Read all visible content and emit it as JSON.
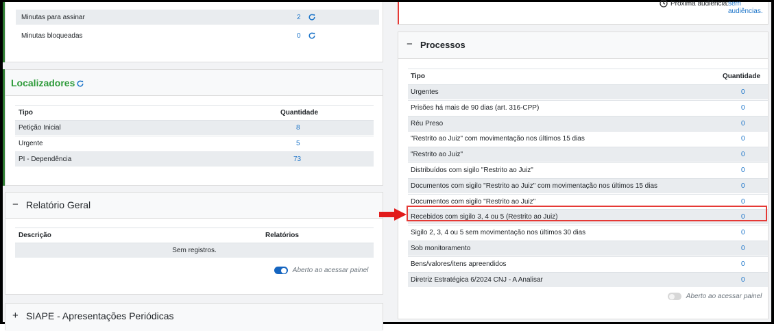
{
  "minutas": {
    "items": [
      {
        "label": "Minutas para assinar",
        "count": "2"
      },
      {
        "label": "Minutas bloqueadas",
        "count": "0"
      }
    ]
  },
  "localizadores": {
    "title": "Localizadores",
    "col_tipo": "Tipo",
    "col_quantidade": "Quantidade",
    "rows": [
      {
        "tipo": "Petição Inicial",
        "qtd": "8"
      },
      {
        "tipo": "Urgente",
        "qtd": "5"
      },
      {
        "tipo": "PI - Dependência",
        "qtd": "73"
      }
    ]
  },
  "relatorio": {
    "toggle_symbol": "−",
    "title": "Relatório Geral",
    "col_descricao": "Descrição",
    "col_relatorios": "Relatórios",
    "empty": "Sem registros.",
    "aberto_label": "Aberto ao acessar painel"
  },
  "siape": {
    "toggle_symbol": "+",
    "title": "SIAPE - Apresentações Periódicas"
  },
  "audiencia": {
    "label": "Próxima audiência:",
    "value": "sem audiências."
  },
  "processos": {
    "toggle_symbol": "−",
    "title": "Processos",
    "col_tipo": "Tipo",
    "col_quantidade": "Quantidade",
    "rows": [
      {
        "tipo": "Urgentes",
        "qtd": "0"
      },
      {
        "tipo": "Prisões há mais de 90 dias (art. 316-CPP)",
        "qtd": "0"
      },
      {
        "tipo": "Réu Preso",
        "qtd": "0"
      },
      {
        "tipo": "\"Restrito ao Juiz\" com movimentação nos últimos 15 dias",
        "qtd": "0"
      },
      {
        "tipo": "\"Restrito ao Juiz\"",
        "qtd": "0"
      },
      {
        "tipo": "Distribuídos com sigilo \"Restrito ao Juiz\"",
        "qtd": "0"
      },
      {
        "tipo": "Documentos com sigilo \"Restrito ao Juiz\" com movimentação nos últimos 15 dias",
        "qtd": "0"
      },
      {
        "tipo": "Documentos com sigilo \"Restrito ao Juiz\"",
        "qtd": "0"
      },
      {
        "tipo": "Recebidos com sigilo 3, 4 ou 5 (Restrito ao Juiz)",
        "qtd": "0"
      },
      {
        "tipo": "Sigilo 2, 3, 4 ou 5 sem movimentação nos últimos 30 dias",
        "qtd": "0"
      },
      {
        "tipo": "Sob monitoramento",
        "qtd": "0"
      },
      {
        "tipo": "Bens/valores/itens apreendidos",
        "qtd": "0"
      },
      {
        "tipo": "Diretriz Estratégica 6/2024 CNJ - A Analisar",
        "qtd": "0"
      }
    ],
    "aberto_label": "Aberto ao acessar painel"
  },
  "colors": {
    "link": "#1a73c8",
    "green": "#2e7d32",
    "highlight_border": "#e53935",
    "arrow": "#e21b1b",
    "toggle_on": "#1565c0"
  },
  "icons": {
    "refresh": "refresh-icon",
    "clock": "clock-icon",
    "arrow": "arrow-right-icon"
  }
}
